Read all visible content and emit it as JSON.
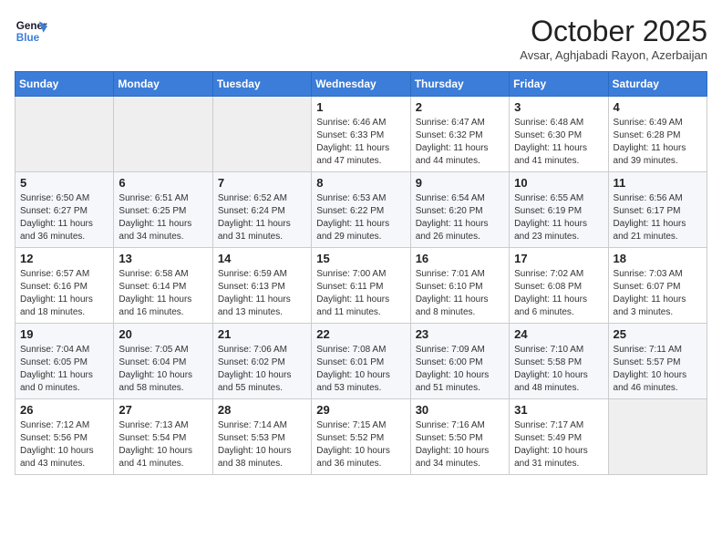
{
  "header": {
    "logo_line1": "General",
    "logo_line2": "Blue",
    "month": "October 2025",
    "location": "Avsar, Aghjabadi Rayon, Azerbaijan"
  },
  "weekdays": [
    "Sunday",
    "Monday",
    "Tuesday",
    "Wednesday",
    "Thursday",
    "Friday",
    "Saturday"
  ],
  "weeks": [
    [
      {
        "day": "",
        "info": ""
      },
      {
        "day": "",
        "info": ""
      },
      {
        "day": "",
        "info": ""
      },
      {
        "day": "1",
        "info": "Sunrise: 6:46 AM\nSunset: 6:33 PM\nDaylight: 11 hours\nand 47 minutes."
      },
      {
        "day": "2",
        "info": "Sunrise: 6:47 AM\nSunset: 6:32 PM\nDaylight: 11 hours\nand 44 minutes."
      },
      {
        "day": "3",
        "info": "Sunrise: 6:48 AM\nSunset: 6:30 PM\nDaylight: 11 hours\nand 41 minutes."
      },
      {
        "day": "4",
        "info": "Sunrise: 6:49 AM\nSunset: 6:28 PM\nDaylight: 11 hours\nand 39 minutes."
      }
    ],
    [
      {
        "day": "5",
        "info": "Sunrise: 6:50 AM\nSunset: 6:27 PM\nDaylight: 11 hours\nand 36 minutes."
      },
      {
        "day": "6",
        "info": "Sunrise: 6:51 AM\nSunset: 6:25 PM\nDaylight: 11 hours\nand 34 minutes."
      },
      {
        "day": "7",
        "info": "Sunrise: 6:52 AM\nSunset: 6:24 PM\nDaylight: 11 hours\nand 31 minutes."
      },
      {
        "day": "8",
        "info": "Sunrise: 6:53 AM\nSunset: 6:22 PM\nDaylight: 11 hours\nand 29 minutes."
      },
      {
        "day": "9",
        "info": "Sunrise: 6:54 AM\nSunset: 6:20 PM\nDaylight: 11 hours\nand 26 minutes."
      },
      {
        "day": "10",
        "info": "Sunrise: 6:55 AM\nSunset: 6:19 PM\nDaylight: 11 hours\nand 23 minutes."
      },
      {
        "day": "11",
        "info": "Sunrise: 6:56 AM\nSunset: 6:17 PM\nDaylight: 11 hours\nand 21 minutes."
      }
    ],
    [
      {
        "day": "12",
        "info": "Sunrise: 6:57 AM\nSunset: 6:16 PM\nDaylight: 11 hours\nand 18 minutes."
      },
      {
        "day": "13",
        "info": "Sunrise: 6:58 AM\nSunset: 6:14 PM\nDaylight: 11 hours\nand 16 minutes."
      },
      {
        "day": "14",
        "info": "Sunrise: 6:59 AM\nSunset: 6:13 PM\nDaylight: 11 hours\nand 13 minutes."
      },
      {
        "day": "15",
        "info": "Sunrise: 7:00 AM\nSunset: 6:11 PM\nDaylight: 11 hours\nand 11 minutes."
      },
      {
        "day": "16",
        "info": "Sunrise: 7:01 AM\nSunset: 6:10 PM\nDaylight: 11 hours\nand 8 minutes."
      },
      {
        "day": "17",
        "info": "Sunrise: 7:02 AM\nSunset: 6:08 PM\nDaylight: 11 hours\nand 6 minutes."
      },
      {
        "day": "18",
        "info": "Sunrise: 7:03 AM\nSunset: 6:07 PM\nDaylight: 11 hours\nand 3 minutes."
      }
    ],
    [
      {
        "day": "19",
        "info": "Sunrise: 7:04 AM\nSunset: 6:05 PM\nDaylight: 11 hours\nand 0 minutes."
      },
      {
        "day": "20",
        "info": "Sunrise: 7:05 AM\nSunset: 6:04 PM\nDaylight: 10 hours\nand 58 minutes."
      },
      {
        "day": "21",
        "info": "Sunrise: 7:06 AM\nSunset: 6:02 PM\nDaylight: 10 hours\nand 55 minutes."
      },
      {
        "day": "22",
        "info": "Sunrise: 7:08 AM\nSunset: 6:01 PM\nDaylight: 10 hours\nand 53 minutes."
      },
      {
        "day": "23",
        "info": "Sunrise: 7:09 AM\nSunset: 6:00 PM\nDaylight: 10 hours\nand 51 minutes."
      },
      {
        "day": "24",
        "info": "Sunrise: 7:10 AM\nSunset: 5:58 PM\nDaylight: 10 hours\nand 48 minutes."
      },
      {
        "day": "25",
        "info": "Sunrise: 7:11 AM\nSunset: 5:57 PM\nDaylight: 10 hours\nand 46 minutes."
      }
    ],
    [
      {
        "day": "26",
        "info": "Sunrise: 7:12 AM\nSunset: 5:56 PM\nDaylight: 10 hours\nand 43 minutes."
      },
      {
        "day": "27",
        "info": "Sunrise: 7:13 AM\nSunset: 5:54 PM\nDaylight: 10 hours\nand 41 minutes."
      },
      {
        "day": "28",
        "info": "Sunrise: 7:14 AM\nSunset: 5:53 PM\nDaylight: 10 hours\nand 38 minutes."
      },
      {
        "day": "29",
        "info": "Sunrise: 7:15 AM\nSunset: 5:52 PM\nDaylight: 10 hours\nand 36 minutes."
      },
      {
        "day": "30",
        "info": "Sunrise: 7:16 AM\nSunset: 5:50 PM\nDaylight: 10 hours\nand 34 minutes."
      },
      {
        "day": "31",
        "info": "Sunrise: 7:17 AM\nSunset: 5:49 PM\nDaylight: 10 hours\nand 31 minutes."
      },
      {
        "day": "",
        "info": ""
      }
    ]
  ]
}
